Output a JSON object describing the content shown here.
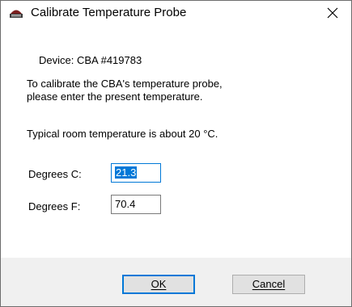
{
  "window": {
    "title": "Calibrate Temperature Probe",
    "icon": "probe-icon",
    "close_icon": "close-icon"
  },
  "device": "Device: CBA #419783",
  "instructions": [
    "To calibrate the CBA's temperature probe,",
    "please enter the present temperature."
  ],
  "typical": "Typical room temperature is about 20 °C.",
  "fields": {
    "celsius": {
      "label": "Degrees C:",
      "value": "21.3"
    },
    "fahrenheit": {
      "label": "Degrees F:",
      "value": "70.4"
    }
  },
  "buttons": {
    "ok": "OK",
    "cancel": "Cancel"
  },
  "colors": {
    "accent": "#0078d7",
    "footer_bg": "#f0f0f0",
    "button_bg": "#e1e1e1"
  }
}
